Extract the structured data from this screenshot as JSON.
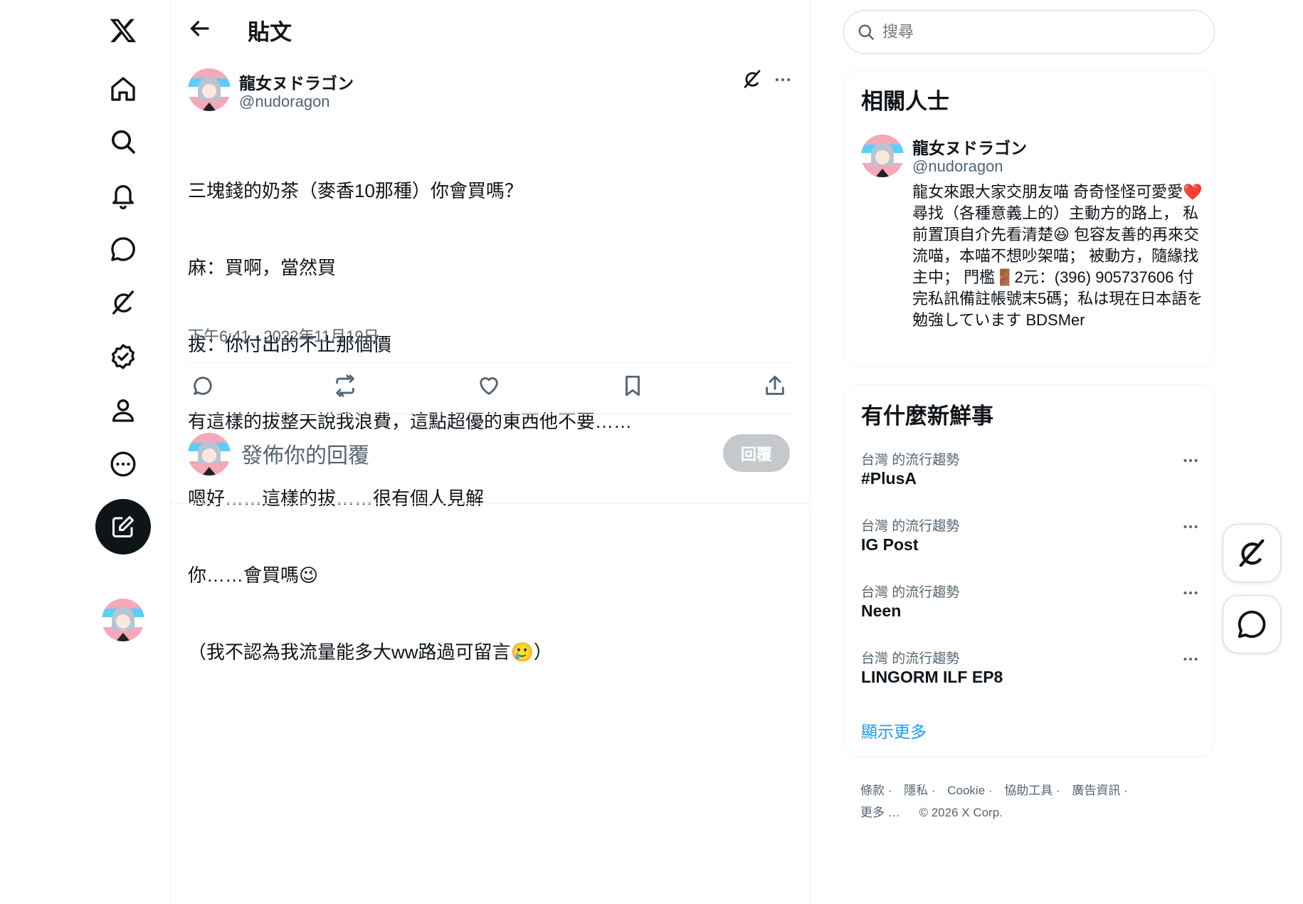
{
  "header": {
    "title": "貼文"
  },
  "search": {
    "placeholder": "搜尋"
  },
  "tweet": {
    "author_name": "龍女ヌドラゴン",
    "author_handle": "@nudoragon",
    "lines": [
      "三塊錢的奶茶（麥香10那種）你會買嗎？",
      "麻：買啊，當然買",
      "拔：你付出的不止那個價",
      "有這樣的拔整天說我浪費，這點超優的東西他不要……",
      "嗯好……這樣的拔……很有個人見解",
      "你……會買嗎😉",
      "（我不認為我流量能多大ww路過可留言🥲）"
    ],
    "timestamp": "下午6:41 · 2022年11月19日"
  },
  "reply": {
    "placeholder": "發佈你的回覆",
    "button_label": "回覆"
  },
  "related": {
    "title": "相關人士",
    "name": "龍女ヌドラゴン",
    "handle": "@nudoragon",
    "bio": "龍女來跟大家交朋友喵 奇奇怪怪可愛愛❤️ 尋找（各種意義上的）主動方的路上， 私前置頂自介先看清楚😆 包容友善的再來交流喵，本喵不想吵架喵； 被動方，隨緣找主中； 門檻🚪2元：(396) 905737606 付完私訊備註帳號末5碼；私は現在日本語を勉強しています BDSMer"
  },
  "trends": {
    "title": "有什麼新鮮事",
    "items": [
      {
        "context": "台灣 的流行趨勢",
        "name": "#PlusA"
      },
      {
        "context": "台灣 的流行趨勢",
        "name": "IG Post"
      },
      {
        "context": "台灣 的流行趨勢",
        "name": "Neen"
      },
      {
        "context": "台灣 的流行趨勢",
        "name": "LINGORM ILF EP8"
      }
    ],
    "show_more": "顯示更多"
  },
  "footer": {
    "links": [
      "條款 ·",
      "隱私 ·",
      "Cookie ·",
      "協助工具 ·",
      "廣告資訊 ·"
    ],
    "more": "更多 …",
    "copyright": "© 2026 X Corp."
  },
  "colors": {
    "accent": "#1d9bf0",
    "text": "#0f1419",
    "muted": "#536471",
    "border": "#eff3f4"
  },
  "icons": [
    "x-logo-icon",
    "home-icon",
    "search-icon",
    "bell-icon",
    "chat-icon",
    "grok-icon",
    "verified-icon",
    "profile-icon",
    "more-icon",
    "compose-icon"
  ]
}
